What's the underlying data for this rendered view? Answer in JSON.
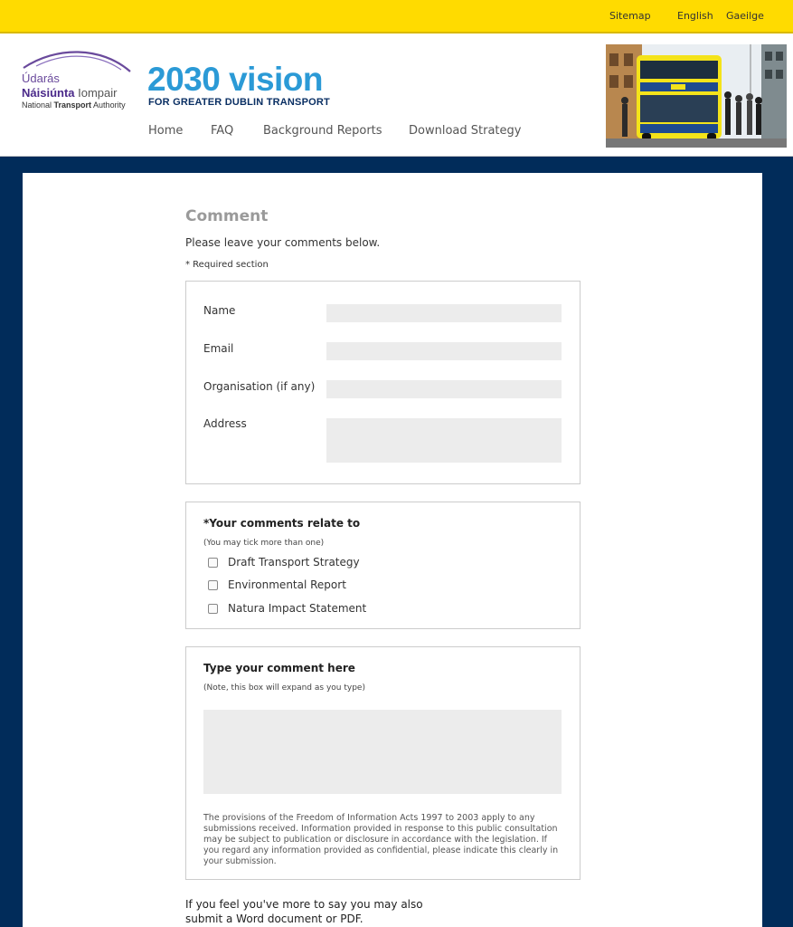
{
  "topbar": {
    "sitemap": "Sitemap",
    "english": "English",
    "gaeilge": "Gaeilge"
  },
  "logo": {
    "line1": "Údarás",
    "line2_bold": "Náisiúnta",
    "line2_light": "Iompair",
    "line3_a": "National ",
    "line3_b": "Transport",
    "line3_c": " Authority"
  },
  "brand": {
    "title": "2030 vision",
    "subtitle": "FOR GREATER DUBLIN TRANSPORT"
  },
  "nav": {
    "home": "Home",
    "faq": "FAQ",
    "background_reports": "Background Reports",
    "download_strategy": "Download Strategy"
  },
  "page": {
    "title": "Comment",
    "intro": "Please leave your comments below.",
    "required_note": "* Required section"
  },
  "form": {
    "name_label": "Name",
    "name_value": "",
    "email_label": "Email",
    "email_value": "",
    "org_label": "Organisation (if any)",
    "org_value": "",
    "address_label": "Address",
    "address_value": ""
  },
  "relate": {
    "title": "*Your comments relate to",
    "note": "(You may tick more than one)",
    "options": [
      {
        "label": "Draft Transport Strategy",
        "checked": false
      },
      {
        "label": "Environmental Report",
        "checked": false
      },
      {
        "label": "Natura Impact Statement",
        "checked": false
      }
    ]
  },
  "comment": {
    "title": "Type your comment here",
    "note": "(Note, this box will expand as you type)",
    "value": "",
    "foi_text": "The provisions of the Freedom of Information Acts 1997 to 2003 apply to any submissions received. Information provided in response to this public consultation may be subject to publication or disclosure in accordance with the legislation. If you regard any information provided as confidential, please indicate this clearly in your submission."
  },
  "footer_note": {
    "line1": "If you feel you've more to say you may also",
    "line2": "submit a Word document or PDF."
  },
  "colors": {
    "topbar": "#ffdb00",
    "page_bg": "#012c5a",
    "brand_blue": "#2b9ad6",
    "brand_navy": "#0a2f63",
    "nta_purple": "#4b2a8a"
  }
}
